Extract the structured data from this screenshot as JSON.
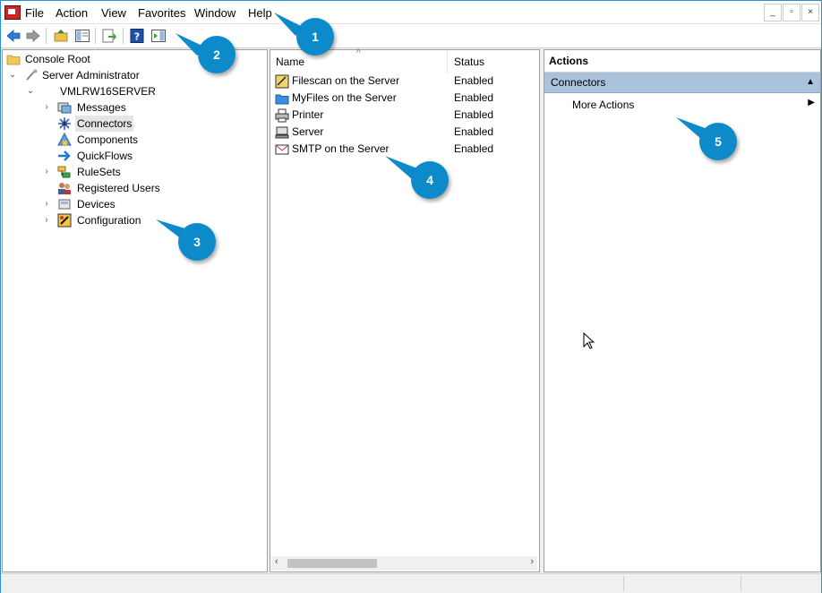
{
  "menubar": {
    "items": [
      "File",
      "Action",
      "View",
      "Favorites",
      "Window",
      "Help"
    ],
    "window_buttons": [
      "_",
      "▫",
      "×"
    ]
  },
  "tree": {
    "root": "Console Root",
    "server_admin": "Server Administrator",
    "server": "VMLRW16SERVER",
    "children": [
      "Messages",
      "Connectors",
      "Components",
      "QuickFlows",
      "RuleSets",
      "Registered Users",
      "Devices",
      "Configuration"
    ]
  },
  "list": {
    "columns": [
      "Name",
      "Status"
    ],
    "rows": [
      {
        "name": "Filescan on the Server",
        "status": "Enabled"
      },
      {
        "name": "MyFiles on the Server",
        "status": "Enabled"
      },
      {
        "name": "Printer",
        "status": "Enabled"
      },
      {
        "name": "Server",
        "status": "Enabled"
      },
      {
        "name": "SMTP on the Server",
        "status": "Enabled"
      }
    ]
  },
  "actions": {
    "title": "Actions",
    "section": "Connectors",
    "items": [
      "More Actions"
    ]
  },
  "callouts": [
    "1",
    "2",
    "3",
    "4",
    "5"
  ],
  "colors": {
    "accent": "#0d8ac9",
    "section": "#a9c3dd",
    "border": "#2b8fd6"
  }
}
